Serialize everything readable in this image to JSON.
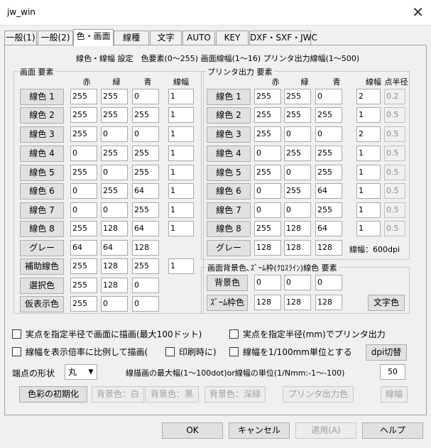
{
  "window": {
    "title": "jw_win"
  },
  "tabs": [
    "一般(1)",
    "一般(2)",
    "色・画面",
    "線種",
    "文字",
    "AUTO",
    "KEY",
    "DXF・SXF・JWC"
  ],
  "header": "線色・線幅 設定　色要素(0〜255) 画面線幅(1〜16) プリンタ出力線幅(1〜500)",
  "screen_group": {
    "title": "画面 要素",
    "cols": [
      "赤",
      "緑",
      "青",
      "線幅"
    ],
    "rows": [
      {
        "label": "線色 1",
        "r": "255",
        "g": "255",
        "b": "0",
        "w": "1"
      },
      {
        "label": "線色 2",
        "r": "255",
        "g": "255",
        "b": "255",
        "w": "1"
      },
      {
        "label": "線色 3",
        "r": "255",
        "g": "0",
        "b": "0",
        "w": "1"
      },
      {
        "label": "線色 4",
        "r": "0",
        "g": "255",
        "b": "255",
        "w": "1"
      },
      {
        "label": "線色 5",
        "r": "255",
        "g": "0",
        "b": "255",
        "w": "1"
      },
      {
        "label": "線色 6",
        "r": "0",
        "g": "255",
        "b": "64",
        "w": "1"
      },
      {
        "label": "線色 7",
        "r": "0",
        "g": "0",
        "b": "255",
        "w": "1"
      },
      {
        "label": "線色 8",
        "r": "255",
        "g": "128",
        "b": "64",
        "w": "1"
      },
      {
        "label": "グレー",
        "r": "64",
        "g": "64",
        "b": "128",
        "w": ""
      },
      {
        "label": "補助線色",
        "r": "255",
        "g": "128",
        "b": "255",
        "w": "1"
      },
      {
        "label": "選択色",
        "r": "255",
        "g": "128",
        "b": "0",
        "w": ""
      },
      {
        "label": "仮表示色",
        "r": "255",
        "g": "0",
        "b": "0",
        "w": ""
      }
    ]
  },
  "printer_group": {
    "title": "プリンタ出力 要素",
    "cols": [
      "赤",
      "緑",
      "青",
      "線幅",
      "点半径"
    ],
    "rows": [
      {
        "label": "線色 1",
        "r": "255",
        "g": "255",
        "b": "0",
        "w": "2",
        "p": "0.2"
      },
      {
        "label": "線色 2",
        "r": "255",
        "g": "255",
        "b": "255",
        "w": "1",
        "p": "0.5"
      },
      {
        "label": "線色 3",
        "r": "255",
        "g": "0",
        "b": "0",
        "w": "2",
        "p": "0.5"
      },
      {
        "label": "線色 4",
        "r": "0",
        "g": "255",
        "b": "255",
        "w": "1",
        "p": "0.5"
      },
      {
        "label": "線色 5",
        "r": "255",
        "g": "0",
        "b": "255",
        "w": "1",
        "p": "0.5"
      },
      {
        "label": "線色 6",
        "r": "0",
        "g": "255",
        "b": "64",
        "w": "1",
        "p": "0.5"
      },
      {
        "label": "線色 7",
        "r": "0",
        "g": "0",
        "b": "255",
        "w": "1",
        "p": "0.5"
      },
      {
        "label": "線色 8",
        "r": "255",
        "g": "128",
        "b": "64",
        "w": "1",
        "p": "0.5"
      },
      {
        "label": "グレー",
        "r": "128",
        "g": "128",
        "b": "128",
        "w": "",
        "p": ""
      }
    ],
    "dpi_label": "線幅：600dpi"
  },
  "bg_group": {
    "title": "画面背景色､ｽﾞｰﾑ枠(ｸﾛｽﾗｲﾝ)線色 要素",
    "rows": [
      {
        "label": "背景色",
        "r": "0",
        "g": "0",
        "b": "0"
      },
      {
        "label": "ｽﾞｰﾑ枠色",
        "r": "128",
        "g": "128",
        "b": "128"
      }
    ],
    "text_color_btn": "文字色"
  },
  "options": {
    "chk_screen_radius": "実点を指定半径で画面に描画(最大100ドット)",
    "chk_printer_radius": "実点を指定半径(mm)でプリンタ出力",
    "chk_proportional": "線幅を表示倍率に比例して描画(",
    "chk_print_time": "印刷時に)",
    "chk_1_100mm": "線幅を1/100mm単位とする",
    "dpi_btn": "dpi切替",
    "endpoint_label": "端点の形状",
    "endpoint_value": "丸",
    "maxwidth_label": "線描画の最大幅(1〜100dot)or線幅の単位(1/Nmm:-1〜-100)",
    "maxwidth_value": "50"
  },
  "bottom_buttons": {
    "init": "色彩の初期化",
    "bg_white": "背景色：白",
    "bg_black": "背景色：黒",
    "bg_green": "背景色：深緑",
    "printer_color": "プリンタ出力色",
    "line_width": "線幅"
  },
  "dialog_buttons": {
    "ok": "OK",
    "cancel": "キャンセル",
    "apply": "適用(A)",
    "help": "ヘルプ"
  }
}
